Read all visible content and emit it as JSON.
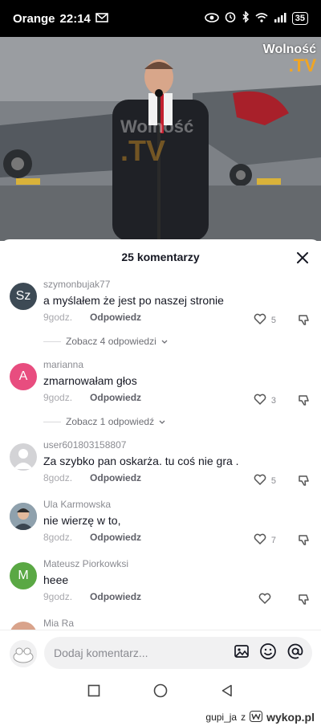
{
  "status_bar": {
    "carrier": "Orange",
    "time": "22:14",
    "battery": "35"
  },
  "video": {
    "watermark_line1": "Wolność",
    "watermark_line2": ".TV",
    "watermark_small1": "Wolność",
    "watermark_small2": ".TV"
  },
  "comments_sheet": {
    "title": "25 komentarzy",
    "comments": [
      {
        "user": "szymonbujak77",
        "avatar_letter": "Sz",
        "avatar_color": "#3d4a55",
        "text": "a myślałem że jest po naszej stronie",
        "time": "9godz.",
        "reply": "Odpowiedz",
        "likes": "5"
      },
      {
        "user": "marianna",
        "avatar_letter": "A",
        "avatar_color": "#e84d7f",
        "text": "zmarnowałam głos",
        "time": "9godz.",
        "reply": "Odpowiedz",
        "likes": "3"
      },
      {
        "user": "user601803158807",
        "avatar_letter": "",
        "avatar_color": "#d3d3d6",
        "text": "Za szybko pan oskarża. tu coś nie gra .",
        "time": "8godz.",
        "reply": "Odpowiedz",
        "likes": "5"
      },
      {
        "user": "Ula Karmowska",
        "avatar_letter": "",
        "avatar_color": "#7a8a96",
        "text": "nie wierzę w to,",
        "time": "8godz.",
        "reply": "Odpowiedz",
        "likes": "7"
      },
      {
        "user": "Mateusz Piorkowksi",
        "avatar_letter": "M",
        "avatar_color": "#5aa844",
        "text": "heee",
        "time": "9godz.",
        "reply": "Odpowiedz",
        "likes": ""
      },
      {
        "user": "Mia Ra",
        "avatar_letter": "",
        "avatar_color": "#d9a38b",
        "text": "",
        "time": "",
        "reply": "",
        "likes": ""
      }
    ],
    "view_replies": [
      "Zobacz 4 odpowiedzi",
      "Zobacz 1 odpowiedź"
    ]
  },
  "input": {
    "placeholder": "Dodaj komentarz..."
  },
  "footer": {
    "text": "gupi_ja",
    "z": "z",
    "site": "wykop.pl"
  },
  "icons": [
    "mail-icon",
    "eye-icon",
    "alarm-icon",
    "bluetooth-icon",
    "wifi-icon",
    "signal-icon",
    "battery-icon",
    "close-icon",
    "heart-icon",
    "dislike-icon",
    "image-icon",
    "emoji-icon",
    "at-icon",
    "square-nav-icon",
    "circle-nav-icon",
    "back-nav-icon",
    "wykop-logo-icon"
  ]
}
